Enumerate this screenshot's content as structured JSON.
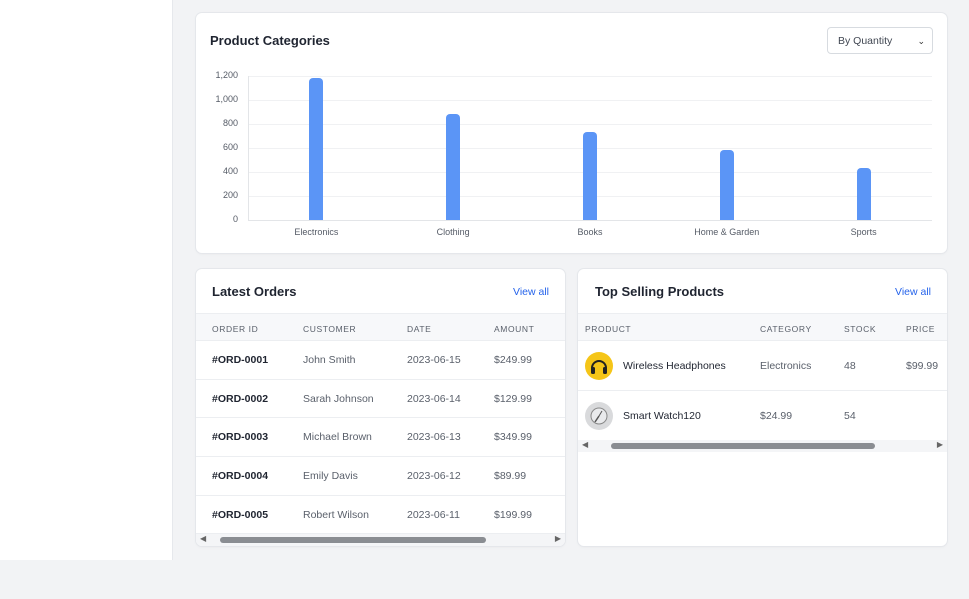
{
  "chart_card": {
    "title": "Product Categories",
    "select_value": "By Quantity"
  },
  "chart_data": {
    "type": "bar",
    "categories": [
      "Electronics",
      "Clothing",
      "Books",
      "Home & Garden",
      "Sports"
    ],
    "values": [
      1180,
      880,
      730,
      580,
      430
    ],
    "ylim": [
      0,
      1200
    ],
    "yticks": [
      "0",
      "200",
      "400",
      "600",
      "800",
      "1,000",
      "1,200"
    ],
    "bar_color": "#5b95f6",
    "grid": true
  },
  "orders": {
    "title": "Latest Orders",
    "view_all": "View all",
    "columns": [
      "ORDER ID",
      "CUSTOMER",
      "DATE",
      "AMOUNT"
    ],
    "rows": [
      {
        "id": "#ORD-0001",
        "customer": "John Smith",
        "date": "2023-06-15",
        "amount": "$249.99"
      },
      {
        "id": "#ORD-0002",
        "customer": "Sarah Johnson",
        "date": "2023-06-14",
        "amount": "$129.99"
      },
      {
        "id": "#ORD-0003",
        "customer": "Michael Brown",
        "date": "2023-06-13",
        "amount": "$349.99"
      },
      {
        "id": "#ORD-0004",
        "customer": "Emily Davis",
        "date": "2023-06-12",
        "amount": "$89.99"
      },
      {
        "id": "#ORD-0005",
        "customer": "Robert Wilson",
        "date": "2023-06-11",
        "amount": "$199.99"
      }
    ]
  },
  "top_products": {
    "title": "Top Selling Products",
    "view_all": "View all",
    "columns": [
      "PRODUCT",
      "CATEGORY",
      "STOCK",
      "PRICE"
    ],
    "rows": [
      {
        "product": "Wireless Headphones",
        "category": "Electronics",
        "stock": "48",
        "price": "$99.99",
        "icon": "headphones-icon"
      },
      {
        "product": "Smart Watch120",
        "category": "$24.99",
        "stock": "54",
        "price": "",
        "icon": "watch-icon"
      }
    ]
  },
  "colors": {
    "accent": "#2563eb",
    "bar": "#5b95f6"
  }
}
